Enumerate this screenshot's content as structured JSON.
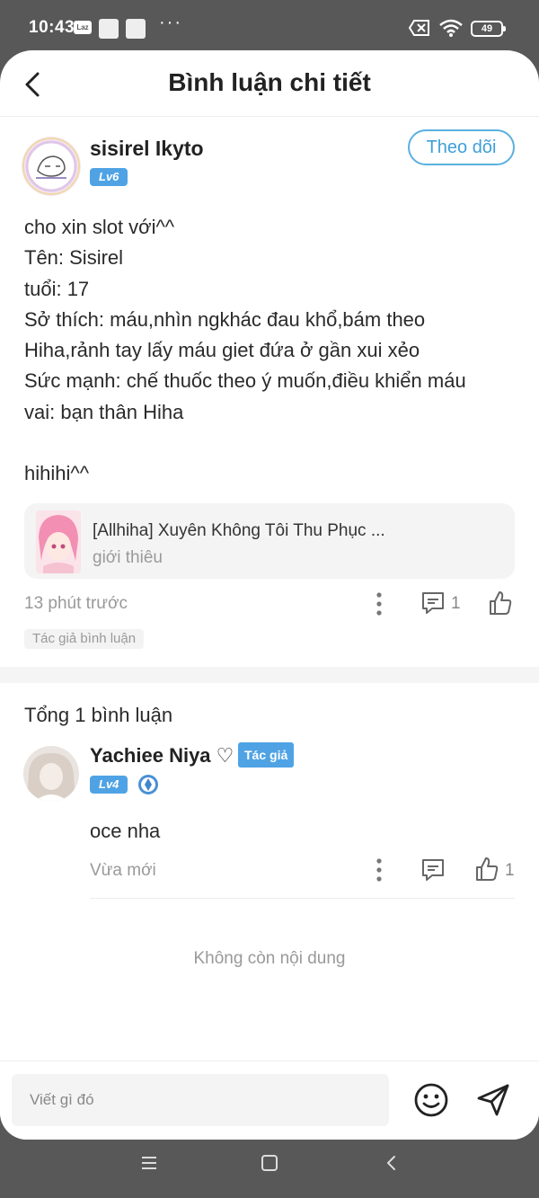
{
  "status_bar": {
    "time": "10:43",
    "laz_label": "Laz",
    "battery": "49"
  },
  "header": {
    "title": "Bình luận chi tiết"
  },
  "post": {
    "author": "sisirel Ikyto",
    "level": "Lv6",
    "follow_label": "Theo dõi",
    "body": "cho xin slot với^^\nTên: Sisirel\ntuổi: 17\nSở thích: máu,nhìn ngkhác đau khổ,bám theo\nHiha,rảnh tay lấy máu giet đứa ở gần xui xẻo\nSức mạnh: chế thuốc theo ý muốn,điều khiển máu\nvai: bạn thân Hiha\n\nhihihi^^",
    "story": {
      "title": "[Allhiha] Xuyên Không Tôi Thu Phục ...",
      "subtitle": "giới thiêu"
    },
    "time": "13 phút trước",
    "reply_count": "1",
    "author_comment_tag": "Tác giả bình luận"
  },
  "comments": {
    "total_label": "Tổng 1 bình luận",
    "items": [
      {
        "author": "Yachiee Niya ♡",
        "author_badge": "Tác giả",
        "level": "Lv4",
        "text": "oce nha",
        "time": "Vừa mới",
        "like_count": "1"
      }
    ],
    "no_more": "Không còn nội dung"
  },
  "input": {
    "placeholder": "Viết gì đó"
  },
  "colors": {
    "accent": "#4fa3e4",
    "follow_border": "#5ab0e0",
    "system_bar": "#585858"
  },
  "icons": [
    "back-icon",
    "more-icon",
    "comment-icon",
    "like-icon",
    "emoji-icon",
    "send-icon",
    "menu-icon",
    "home-icon",
    "nav-back-icon",
    "wifi-icon",
    "sim-off-icon",
    "diamond-icon"
  ]
}
